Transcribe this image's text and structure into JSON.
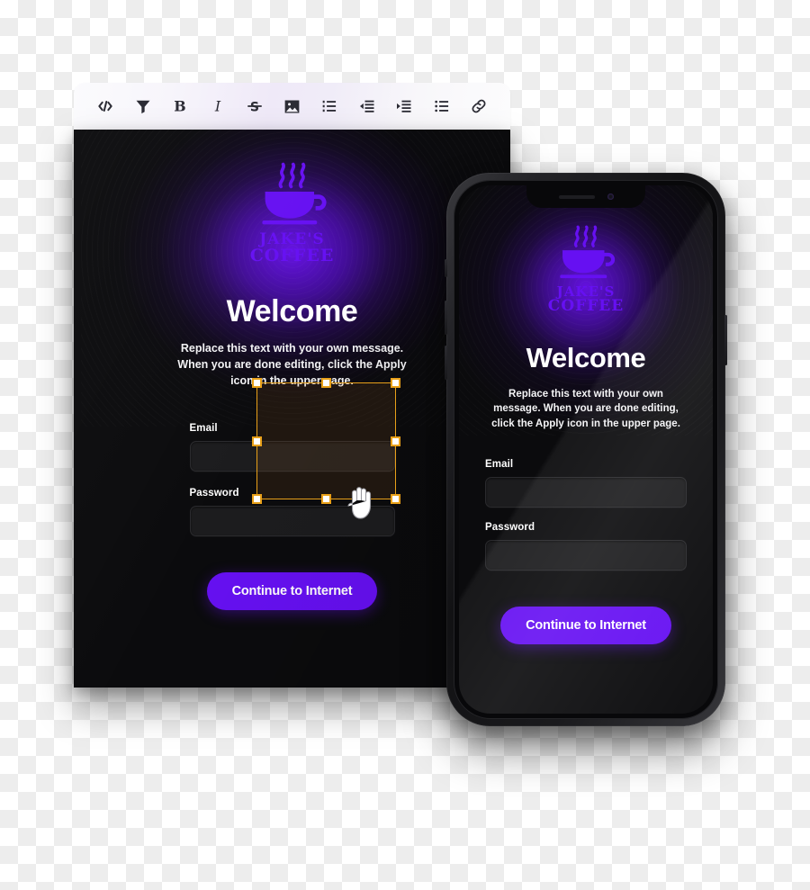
{
  "toolbar": {
    "items": [
      {
        "name": "code-icon",
        "label": "Code"
      },
      {
        "name": "filter-icon",
        "label": "Filter"
      },
      {
        "name": "bold-icon",
        "label": "Bold"
      },
      {
        "name": "italic-icon",
        "label": "Italic"
      },
      {
        "name": "strikethrough-icon",
        "label": "Strikethrough"
      },
      {
        "name": "image-icon",
        "label": "Image"
      },
      {
        "name": "ordered-list-icon",
        "label": "Ordered list"
      },
      {
        "name": "outdent-icon",
        "label": "Decrease indent"
      },
      {
        "name": "indent-icon",
        "label": "Increase indent"
      },
      {
        "name": "bullet-list-icon",
        "label": "Bullet list"
      },
      {
        "name": "link-icon",
        "label": "Link"
      }
    ]
  },
  "brand": {
    "logo_line1": "JAKE'S",
    "logo_line2": "COFFEE",
    "logo_color": "#6610f2",
    "accent_color": "#6610f2",
    "selection_color": "#e8a019"
  },
  "desktop": {
    "heading": "Welcome",
    "blurb": "Replace this text with your own message. When you are done editing, click the Apply icon in the upper page.",
    "email_label": "Email",
    "email_value": "",
    "email_placeholder": "",
    "password_label": "Password",
    "password_value": "",
    "password_placeholder": "",
    "cta_label": "Continue to Internet"
  },
  "phone": {
    "heading": "Welcome",
    "blurb": "Replace this text with your own message. When you are done editing, click the Apply icon in the upper page.",
    "email_label": "Email",
    "email_value": "",
    "email_placeholder": "",
    "password_label": "Password",
    "password_value": "",
    "password_placeholder": "",
    "cta_label": "Continue to Internet"
  }
}
